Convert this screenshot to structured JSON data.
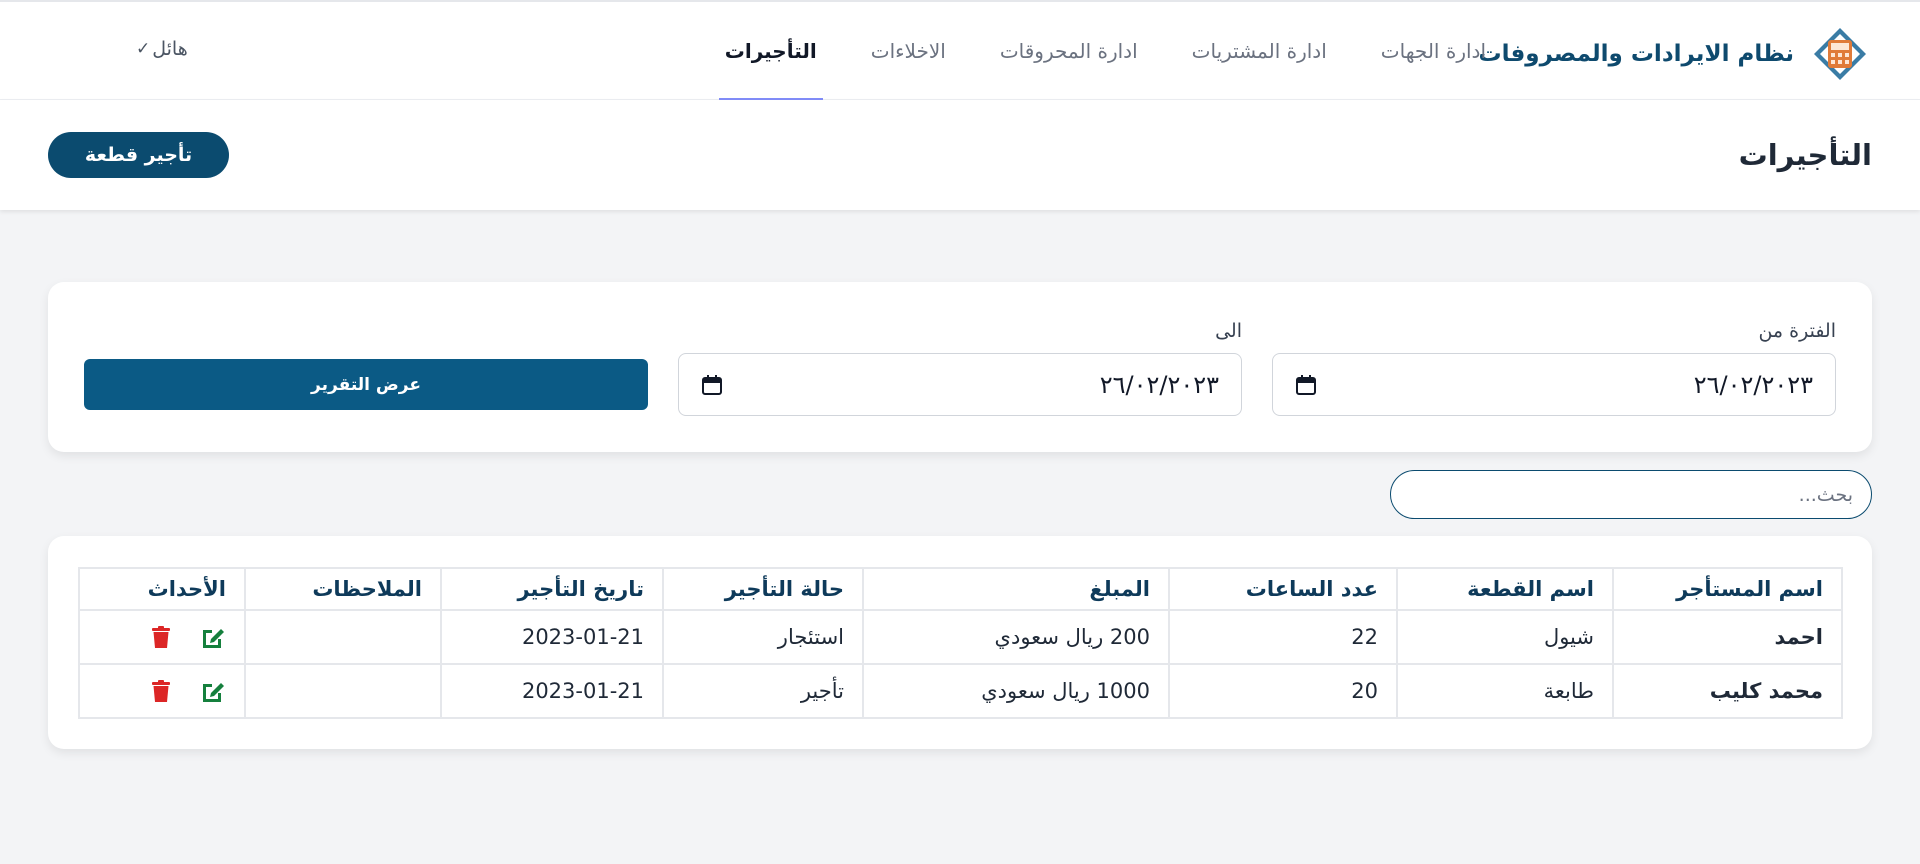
{
  "nav": {
    "brand_title": "نظام الايرادات والمصروفات",
    "links": [
      {
        "label": "ادارة الجهات"
      },
      {
        "label": "ادارة المشتريات"
      },
      {
        "label": "ادارة المحروقات"
      },
      {
        "label": "الاخلاءات"
      },
      {
        "label": "التأجيرات"
      }
    ],
    "active_link": "التأجيرات",
    "user_name": "هائل",
    "user_chevron": "✓"
  },
  "header": {
    "title": "التأجيرات",
    "rent_button": "تأجير قطعة"
  },
  "filter": {
    "from_label": "الفترة من",
    "from_value": "٢٦/٠٢/٢٠٢٣",
    "to_label": "الى",
    "to_value": "٢٦/٠٢/٢٠٢٣",
    "report_button": "عرض التقرير"
  },
  "search": {
    "placeholder": "بحث...",
    "value": ""
  },
  "table": {
    "columns": [
      "اسم المستأجر",
      "اسم القطعة",
      "عدد الساعات",
      "المبلغ",
      "حالة التأجير",
      "تاريخ التأجير",
      "الملاحظات",
      "الأحداث"
    ],
    "rows": [
      {
        "tenant": "احمد",
        "item": "شيول",
        "hours": "22",
        "amount": "200 ريال سعودي",
        "status": "استئجار",
        "date": "2023-01-21",
        "notes": ""
      },
      {
        "tenant": "محمد كليب",
        "item": "طابعة",
        "hours": "20",
        "amount": "1000 ريال سعودي",
        "status": "تأجير",
        "date": "2023-01-21",
        "notes": ""
      }
    ]
  },
  "colors": {
    "brand": "#0e4a6e",
    "primary_button": "#0b5a85",
    "active_tab_underline": "#818cf8",
    "edit_icon": "#15803d",
    "delete_icon": "#dc2626",
    "logo_orange": "#e07b39"
  },
  "icons": {
    "logo": "calculator-diamond-icon",
    "calendar": "calendar-icon",
    "edit": "pencil-square-icon",
    "delete": "trash-icon"
  }
}
